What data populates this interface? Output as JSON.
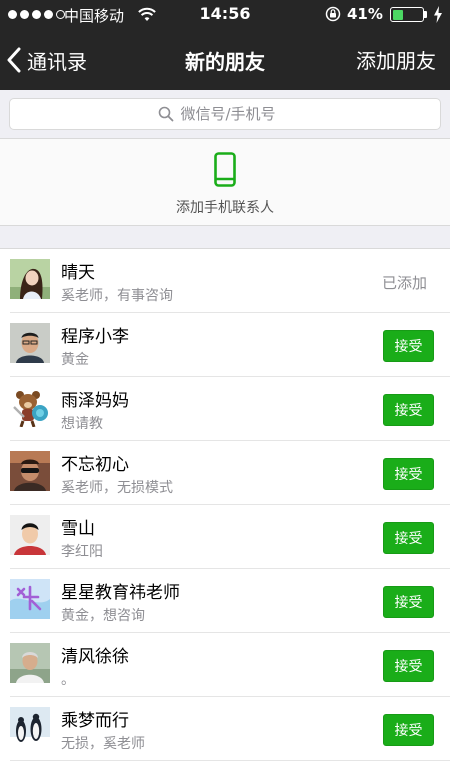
{
  "status_bar": {
    "carrier": "中国移动",
    "time": "14:56",
    "battery": "41%",
    "battery_level": 0.41,
    "signal_strength": 4,
    "signal_max": 5
  },
  "nav": {
    "back_label": "通讯录",
    "title": "新的朋友",
    "action_label": "添加朋友"
  },
  "search": {
    "placeholder": "微信号/手机号"
  },
  "add_contacts": {
    "label": "添加手机联系人"
  },
  "requests": [
    {
      "name": "晴天",
      "message": "奚老师，有事咨询",
      "status": "已添加"
    },
    {
      "name": "程序小李",
      "message": "黄金",
      "action": "接受"
    },
    {
      "name": "雨泽妈妈",
      "message": "想请教",
      "action": "接受"
    },
    {
      "name": "不忘初心",
      "message": "奚老师，无损模式",
      "action": "接受"
    },
    {
      "name": "雪山",
      "message": "李红阳",
      "action": "接受"
    },
    {
      "name": "星星教育祎老师",
      "message": "黄金，想咨询",
      "action": "接受"
    },
    {
      "name": "清风徐徐",
      "message": "。",
      "action": "接受"
    },
    {
      "name": "乘梦而行",
      "message": "无损，奚老师",
      "action": "接受"
    }
  ],
  "colors": {
    "nav_bg": "#262626",
    "accent_green": "#1aad19",
    "battery_green": "#4cd964",
    "background": "#efeff4"
  },
  "icons": {
    "search": "search-icon",
    "phone": "phone-icon",
    "back": "chevron-left-icon"
  }
}
